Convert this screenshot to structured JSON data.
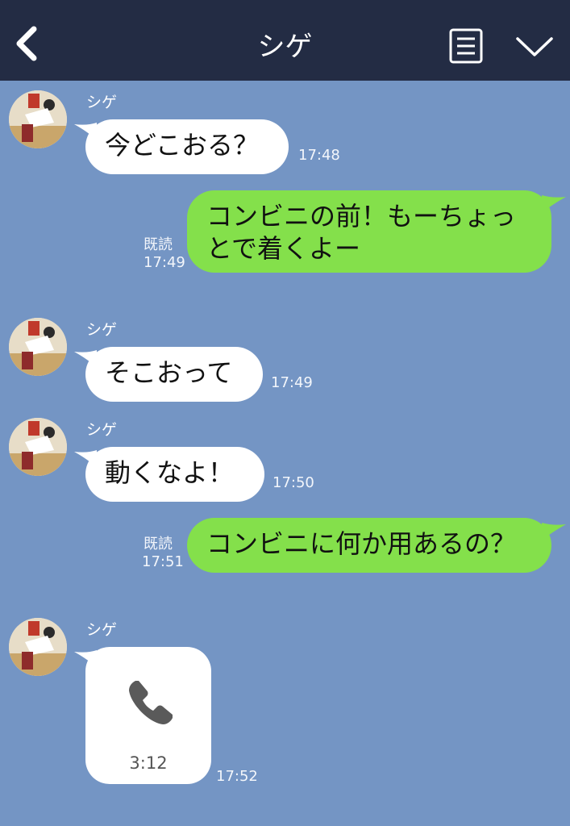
{
  "header": {
    "title": "シゲ",
    "back_icon": "chevron-left-icon",
    "menu_icon": "notes-menu-icon",
    "collapse_icon": "chevron-down-icon",
    "bg": "#232c44"
  },
  "chat_bg": "#7495c4",
  "messages": [
    {
      "from": "シゲ",
      "dir": "in",
      "text": "今どこおる？",
      "time": "17:48"
    },
    {
      "dir": "out",
      "text_line1": "コンビニの前！もーちょっ",
      "text_line2": "とで着くよー",
      "read": "既読",
      "time": "17:49"
    },
    {
      "from": "シゲ",
      "dir": "in",
      "text": "そこおって",
      "time": "17:49"
    },
    {
      "from": "シゲ",
      "dir": "in",
      "text": "動くなよ！",
      "time": "17:50"
    },
    {
      "dir": "out",
      "text": "コンビニに何か用あるの？",
      "read": "既読",
      "time": "17:51"
    },
    {
      "from": "シゲ",
      "dir": "in",
      "type": "call",
      "icon": "phone-icon",
      "duration": "3:12",
      "time": "17:52"
    }
  ],
  "colors": {
    "incoming": "#ffffff",
    "outgoing": "#84e04b"
  }
}
